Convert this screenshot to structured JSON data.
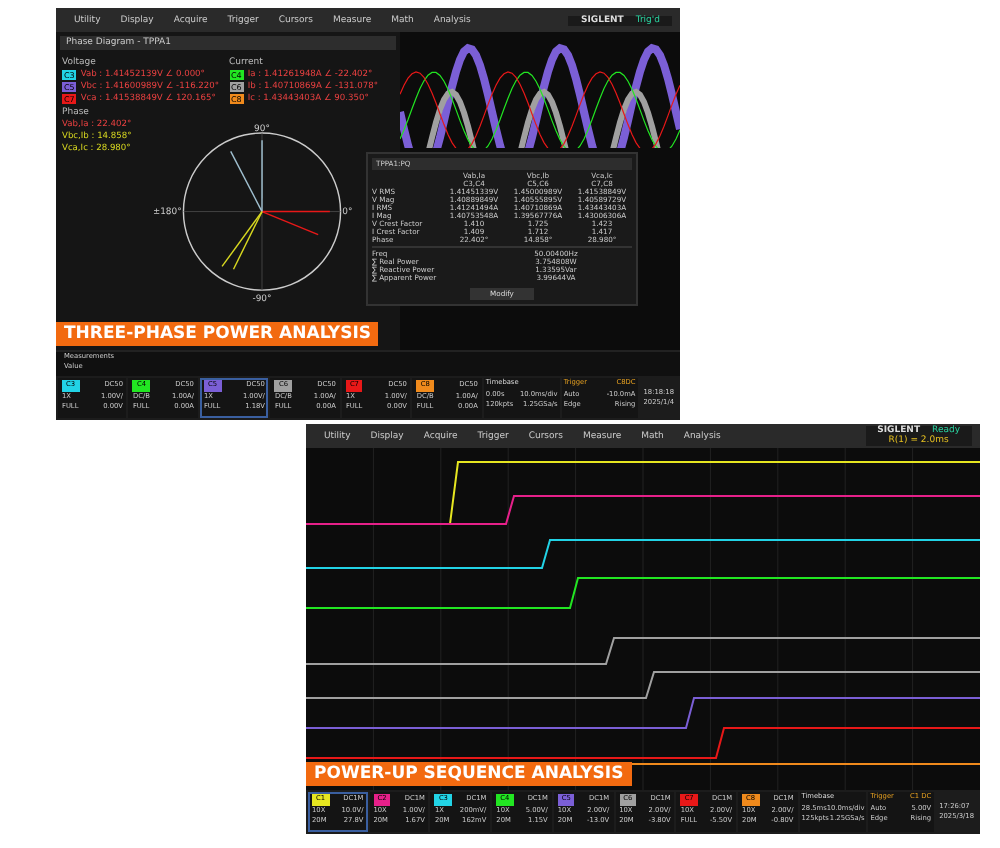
{
  "power_screen": {
    "menu": [
      "Utility",
      "Display",
      "Acquire",
      "Trigger",
      "Cursors",
      "Measure",
      "Math",
      "Analysis"
    ],
    "brand": "SIGLENT",
    "status": "Trig'd",
    "phase_panel": {
      "title": "Phase Diagram - TPPA1",
      "groups": [
        {
          "heading": "Voltage",
          "rows": [
            {
              "tag": "C3",
              "color": "#22d3e6",
              "text": "Vab : 1.41452139V ∠ 0.000°"
            },
            {
              "tag": "C5",
              "color": "#7b5fd6",
              "text": "Vbc : 1.41600989V ∠ -116.220°"
            },
            {
              "tag": "C7",
              "color": "#e81818",
              "text": "Vca : 1.41538849V ∠ 120.165°"
            }
          ]
        },
        {
          "heading": "Current",
          "rows": [
            {
              "tag": "C4",
              "color": "#22e622",
              "text": "Ia : 1.41261948A ∠ -22.402°"
            },
            {
              "tag": "C6",
              "color": "#a0a0a0",
              "text": "Ib : 1.40710869A ∠ -131.078°"
            },
            {
              "tag": "C8",
              "color": "#f08a1c",
              "text": "Ic : 1.43443403A ∠ 90.350°"
            }
          ]
        },
        {
          "heading": "Phase",
          "rows": [
            {
              "text": "Vab,Ia : 22.402°"
            },
            {
              "text": "Vbc,Ib : 14.858°"
            },
            {
              "text": "Vca,Ic : 28.980°"
            }
          ]
        }
      ],
      "axis_labels": [
        "90°",
        "0°",
        "±180°",
        "-90°"
      ]
    },
    "pq_table": {
      "title": "TPPA1:PQ",
      "header_rows": [
        [
          "Vab,Ia",
          "Vbc,Ib",
          "Vca,Ic"
        ],
        [
          "C3,C4",
          "C5,C6",
          "C7,C8"
        ]
      ],
      "rows": [
        {
          "label": "V RMS",
          "cells": [
            "1.41451339V",
            "1.45000989V",
            "1.41538849V"
          ]
        },
        {
          "label": "V Mag",
          "cells": [
            "1.40889849V",
            "1.40555895V",
            "1.40589729V"
          ]
        },
        {
          "label": "I RMS",
          "cells": [
            "1.41241494A",
            "1.40710869A",
            "1.43443403A"
          ]
        },
        {
          "label": "I Mag",
          "cells": [
            "1.40753548A",
            "1.39567776A",
            "1.43006306A"
          ]
        },
        {
          "label": "V Crest Factor",
          "cells": [
            "1.410",
            "1.725",
            "1.423"
          ]
        },
        {
          "label": "I Crest Factor",
          "cells": [
            "1.409",
            "1.712",
            "1.417"
          ]
        },
        {
          "label": "Phase",
          "cells": [
            "22.402°",
            "14.858°",
            "28.980°"
          ]
        }
      ],
      "summary": [
        {
          "label": "Freq",
          "value": "50.00400Hz"
        },
        {
          "label": "∑ Real Power",
          "value": "3.754808W"
        },
        {
          "label": "∑ Reactive Power",
          "value": "1.33595Var"
        },
        {
          "label": "∑ Apparent Power",
          "value": "3.99644VA"
        }
      ],
      "button": "Modify"
    },
    "measurements_label": "Measurements",
    "measurements_value": "Value",
    "caption": "THREE-PHASE POWER ANALYSIS",
    "channels": [
      {
        "label": "C3",
        "color": "#22d3e6",
        "coupling": "DC50",
        "probe": "1X",
        "scale": "1.00V/",
        "bw": "FULL",
        "offset": "0.00V",
        "selected": false
      },
      {
        "label": "C4",
        "color": "#22e622",
        "coupling": "DC50",
        "probe": "DC/B",
        "scale": "1.00A/",
        "bw": "FULL",
        "offset": "0.00A",
        "selected": false
      },
      {
        "label": "C5",
        "color": "#7b5fd6",
        "coupling": "DC50",
        "probe": "1X",
        "scale": "1.00V/",
        "bw": "FULL",
        "offset": "1.18V",
        "selected": true
      },
      {
        "label": "C6",
        "color": "#a0a0a0",
        "coupling": "DC50",
        "probe": "DC/B",
        "scale": "1.00A/",
        "bw": "FULL",
        "offset": "0.00A",
        "selected": false
      },
      {
        "label": "C7",
        "color": "#e81818",
        "coupling": "DC50",
        "probe": "1X",
        "scale": "1.00V/",
        "bw": "FULL",
        "offset": "0.00V",
        "selected": false
      },
      {
        "label": "C8",
        "color": "#f08a1c",
        "coupling": "DC50",
        "probe": "DC/B",
        "scale": "1.00A/",
        "bw": "FULL",
        "offset": "0.00A",
        "selected": false
      }
    ],
    "timebase": {
      "title": "Timebase",
      "line1": [
        "0.00s",
        "10.0ms/div"
      ],
      "line2": [
        "120kpts",
        "1.25GSa/s"
      ]
    },
    "trigger": {
      "title": "Trigger",
      "source": "C8DC",
      "line1": [
        "Auto",
        "-10.0mA"
      ],
      "line2": [
        "Edge",
        "Rising"
      ]
    },
    "clock": [
      "18:18:18",
      "2025/1/4"
    ]
  },
  "sequence_screen": {
    "menu": [
      "Utility",
      "Display",
      "Acquire",
      "Trigger",
      "Cursors",
      "Measure",
      "Math",
      "Analysis"
    ],
    "brand": "SIGLENT",
    "status": "Ready",
    "readout": "R(1) = 2.0ms",
    "caption": "POWER-UP SEQUENCE ANALYSIS",
    "channels": [
      {
        "label": "C1",
        "color": "#e6e620",
        "coupling": "DC1M",
        "probe": "10X",
        "scale": "10.0V/",
        "bw": "20M",
        "offset": "27.8V",
        "selected": true
      },
      {
        "label": "C2",
        "color": "#e6208a",
        "coupling": "DC1M",
        "probe": "10X",
        "scale": "1.00V/",
        "bw": "20M",
        "offset": "1.67V",
        "selected": false
      },
      {
        "label": "C3",
        "color": "#22d3e6",
        "coupling": "DC1M",
        "probe": "1X",
        "scale": "200mV/",
        "bw": "20M",
        "offset": "162mV",
        "selected": false
      },
      {
        "label": "C4",
        "color": "#22e622",
        "coupling": "DC1M",
        "probe": "10X",
        "scale": "5.00V/",
        "bw": "20M",
        "offset": "1.15V",
        "selected": false
      },
      {
        "label": "C5",
        "color": "#7b5fd6",
        "coupling": "DC1M",
        "probe": "10X",
        "scale": "2.00V/",
        "bw": "20M",
        "offset": "-13.0V",
        "selected": false
      },
      {
        "label": "C6",
        "color": "#a0a0a0",
        "coupling": "DC1M",
        "probe": "10X",
        "scale": "2.00V/",
        "bw": "20M",
        "offset": "-3.80V",
        "selected": false
      },
      {
        "label": "C7",
        "color": "#e81818",
        "coupling": "DC1M",
        "probe": "10X",
        "scale": "2.00V/",
        "bw": "FULL",
        "offset": "-5.50V",
        "selected": false
      },
      {
        "label": "C8",
        "color": "#f08a1c",
        "coupling": "DC1M",
        "probe": "10X",
        "scale": "2.00V/",
        "bw": "20M",
        "offset": "-0.80V",
        "selected": false
      }
    ],
    "timebase": {
      "title": "Timebase",
      "line1": [
        "28.5ms",
        "10.0ms/div"
      ],
      "line2": [
        "125kpts",
        "1.25GSa/s"
      ]
    },
    "trigger": {
      "title": "Trigger",
      "source": "C1 DC",
      "line1": [
        "Auto",
        "5.00V"
      ],
      "line2": [
        "Edge",
        "Rising"
      ]
    },
    "clock": [
      "17:26:07",
      "2025/3/18"
    ]
  }
}
